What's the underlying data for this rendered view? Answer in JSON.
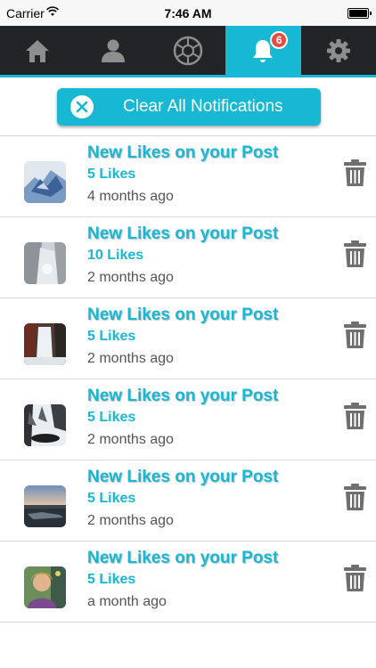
{
  "status_bar": {
    "carrier": "Carrier",
    "time": "7:46 AM"
  },
  "tabs": [
    {
      "name": "home",
      "icon": "home-icon",
      "active": false
    },
    {
      "name": "profile",
      "icon": "person-icon",
      "active": false
    },
    {
      "name": "camera",
      "icon": "aperture-icon",
      "active": false
    },
    {
      "name": "notifications",
      "icon": "bell-icon",
      "active": true,
      "badge": "6"
    },
    {
      "name": "settings",
      "icon": "gear-icon",
      "active": false
    }
  ],
  "clear_button": {
    "label": "Clear All Notifications"
  },
  "notifications": [
    {
      "title": "New Likes on your Post",
      "likes": "5 Likes",
      "ago": "4 months ago",
      "thumb": "ice-sculpture"
    },
    {
      "title": "New Likes on your Post",
      "likes": "10 Likes",
      "ago": "2 months ago",
      "thumb": "frozen-waterfall"
    },
    {
      "title": "New Likes on your Post",
      "likes": "5 Likes",
      "ago": "2 months ago",
      "thumb": "waterfall-rocks"
    },
    {
      "title": "New Likes on your Post",
      "likes": "5 Likes",
      "ago": "2 months ago",
      "thumb": "winter-forest"
    },
    {
      "title": "New Likes on your Post",
      "likes": "5 Likes",
      "ago": "2 months ago",
      "thumb": "sunset-lake"
    },
    {
      "title": "New Likes on your Post",
      "likes": "5 Likes",
      "ago": "a month ago",
      "thumb": "person-selfie"
    }
  ],
  "colors": {
    "accent": "#16b8d4",
    "tabbar": "#232427",
    "badge": "#e84b42",
    "trash": "#6f6f6f"
  }
}
